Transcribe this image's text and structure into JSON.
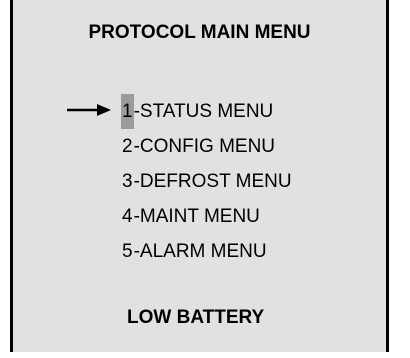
{
  "screen": {
    "title": "PROTOCOL MAIN MENU",
    "menu_items": [
      {
        "number": "1",
        "label": "-STATUS MENU",
        "selected": true
      },
      {
        "number": "2",
        "label": "-CONFIG MENU",
        "selected": false
      },
      {
        "number": "3",
        "label": "-DEFROST MENU",
        "selected": false
      },
      {
        "number": "4",
        "label": "-MAINT MENU",
        "selected": false
      },
      {
        "number": "5",
        "label": "-ALARM MENU",
        "selected": false
      }
    ],
    "status_message": "LOW BATTERY",
    "pointer_icon": "right-arrow-icon"
  },
  "colors": {
    "background": "#e1e1e1",
    "border": "#000000",
    "selection_highlight": "#9b9b9b",
    "text": "#000000"
  }
}
